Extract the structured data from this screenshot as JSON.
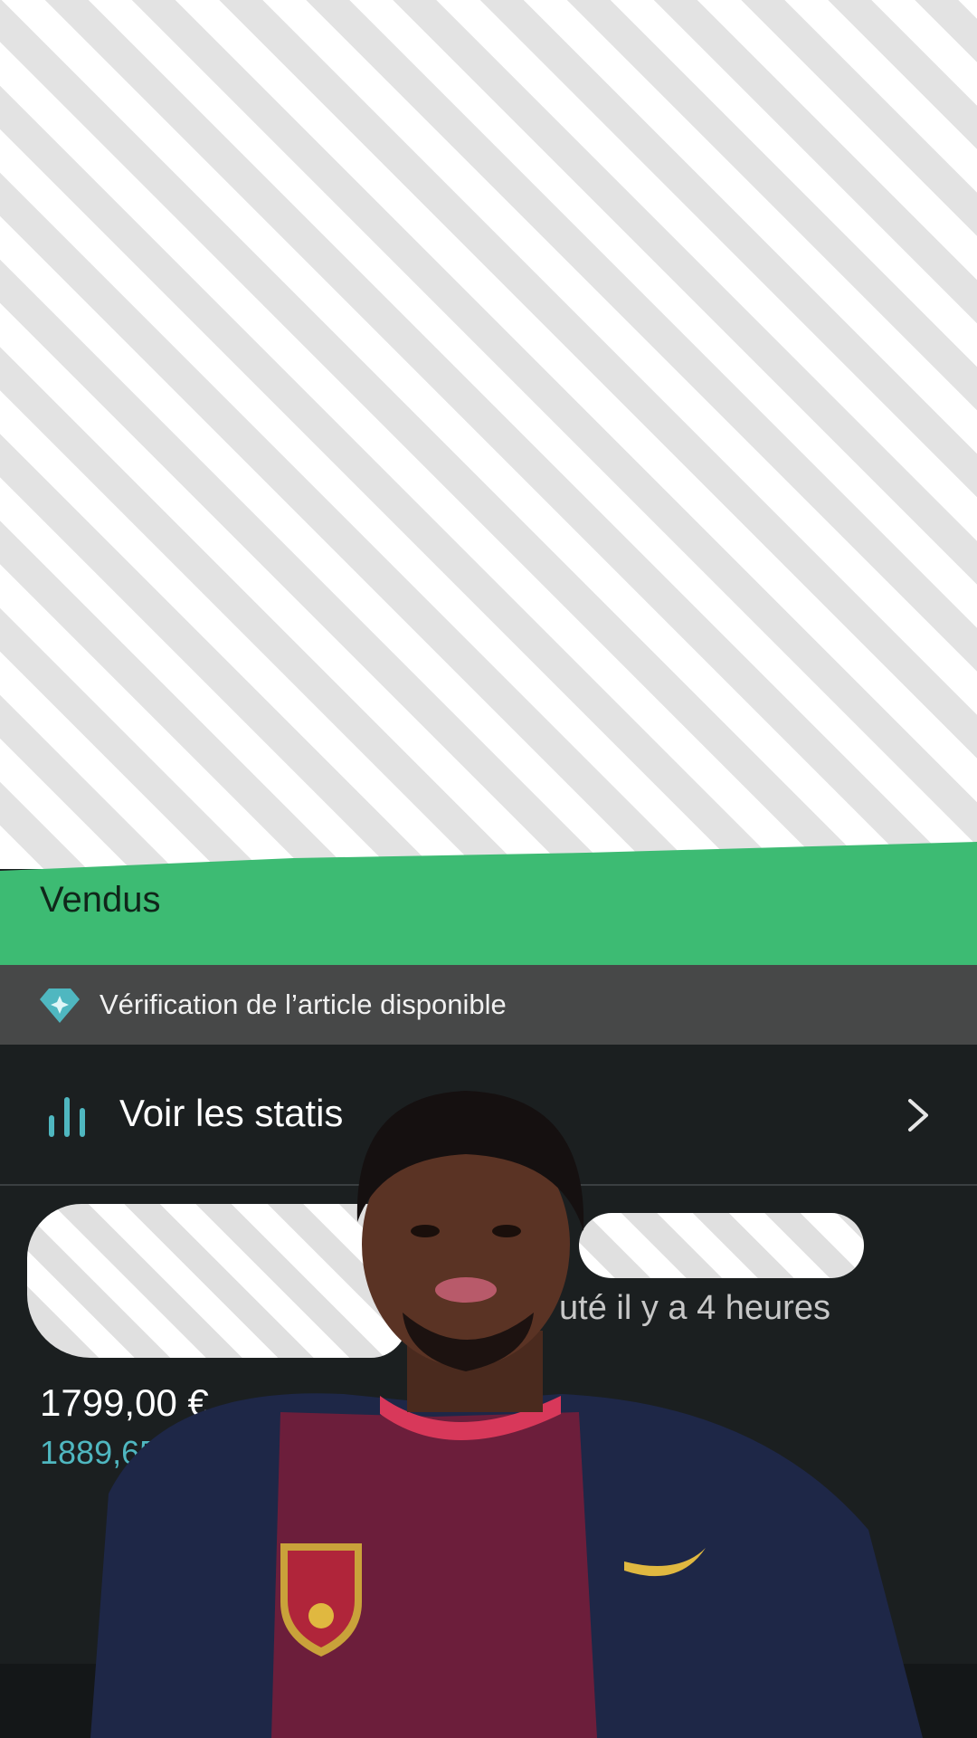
{
  "sold_banner": {
    "label": "Vendus",
    "color": "#3dbb73"
  },
  "verification": {
    "icon": "diamond-icon",
    "text": "Vérification de l’article disponible"
  },
  "stats": {
    "icon": "bar-chart-icon",
    "label": "Voir les statis",
    "chevron": "chevron-right-icon"
  },
  "listing": {
    "time_text": "uté il y a 4 heures",
    "price": "1799,00 €",
    "price_incl": "1889,65 € incl"
  },
  "colors": {
    "accent": "#4fb7c0",
    "background": "#1b1f20"
  }
}
